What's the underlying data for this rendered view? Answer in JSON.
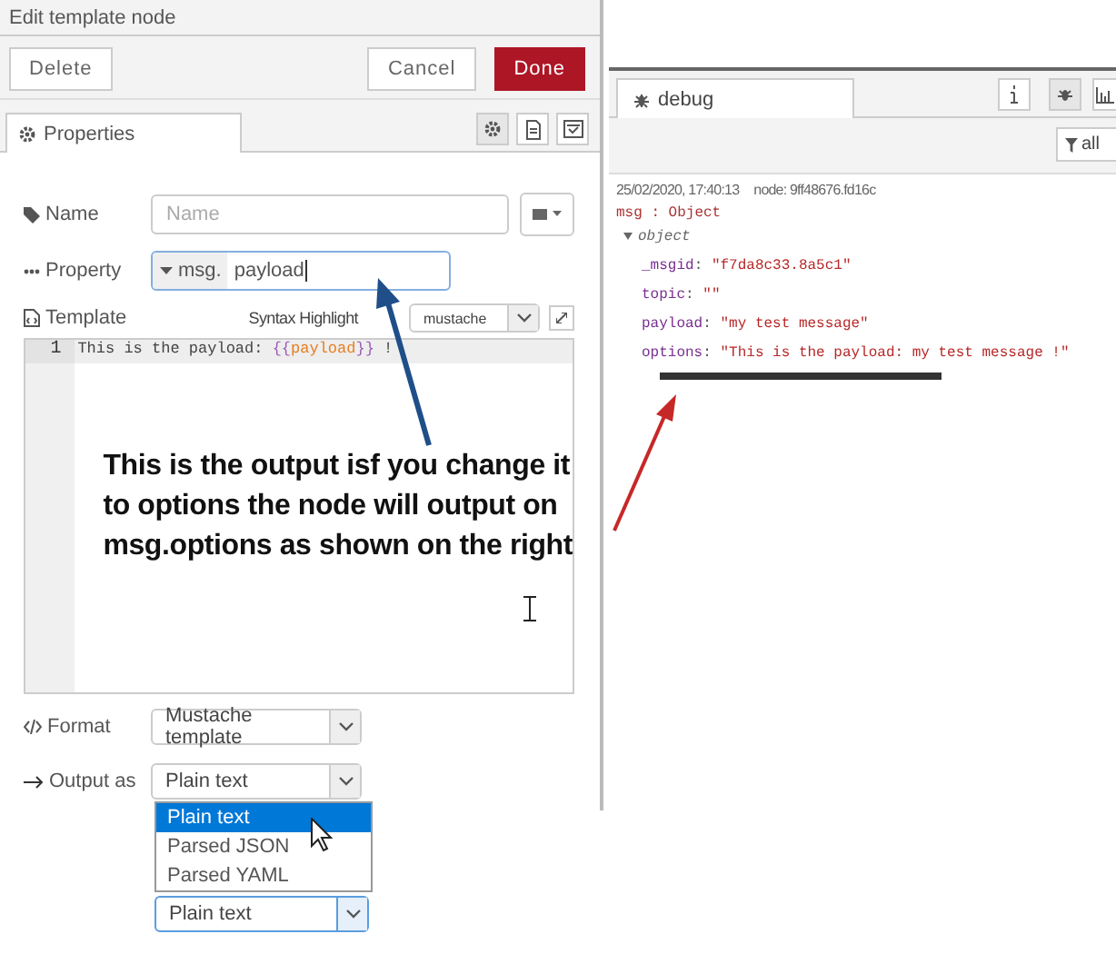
{
  "editor": {
    "title": "Edit template node",
    "buttons": [
      {
        "kind": "secondary",
        "label": "Delete"
      },
      {
        "kind": "spacer"
      },
      {
        "kind": "secondary",
        "label": "Cancel"
      },
      {
        "kind": "primary",
        "label": "Done"
      }
    ],
    "tab": {
      "label": "Properties",
      "selected": true
    },
    "name_field": {
      "label": "Name",
      "placeholder": "Name"
    },
    "property_field": {
      "label": "Property",
      "prefix": "msg.",
      "value": "payload",
      "focused": true
    },
    "template": {
      "label": "Template",
      "syntax_label": "Syntax Highlight",
      "syntax_value": "mustache",
      "lines": [
        {
          "number": "1",
          "segments": [
            {
              "kind": "plain",
              "text": "This is the payload: "
            },
            {
              "kind": "brace",
              "text": "{{"
            },
            {
              "kind": "variable",
              "text": "payload"
            },
            {
              "kind": "brace",
              "text": "}}"
            },
            {
              "kind": "plain",
              "text": " !"
            }
          ]
        }
      ]
    },
    "format": {
      "label": "Format",
      "value": "Mustache template"
    },
    "output": {
      "label": "Output as",
      "value": "Plain text"
    },
    "dropdown_options": [
      {
        "label": "Plain text",
        "selected": true
      },
      {
        "label": "Parsed JSON",
        "selected": false
      },
      {
        "label": "Parsed YAML",
        "selected": false
      }
    ],
    "bottom_select": {
      "value": "Plain text"
    }
  },
  "annotation": {
    "lines": [
      "This is the output isf you change it",
      "to options the node will output on",
      "msg.options as shown on the right"
    ]
  },
  "debug": {
    "tab": {
      "label": "debug",
      "selected": true
    },
    "filter": "all",
    "message": {
      "timestamp": "25/02/2020, 17:40:13",
      "node": "node: 9ff48676.fd16c",
      "type": "msg : Object",
      "object_label": "object",
      "expanded": true,
      "separator": ":",
      "properties": [
        {
          "key": "_msgid",
          "value": "\"f7da8c33.8a5c1\""
        },
        {
          "key": "topic",
          "value": "\"\""
        },
        {
          "key": "payload",
          "value": "\"my test message\""
        },
        {
          "key": "options",
          "value": "\"This is the payload: my test message !\""
        }
      ]
    }
  }
}
